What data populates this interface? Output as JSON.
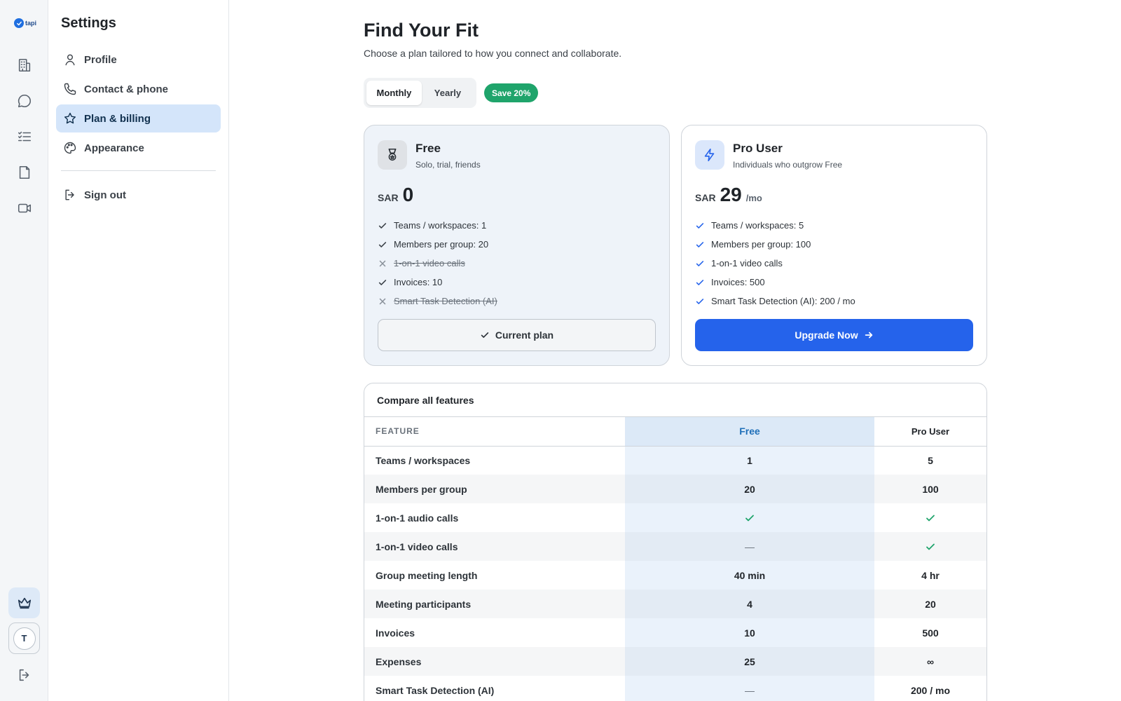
{
  "app": {
    "logo_text": "tapi"
  },
  "settings": {
    "title": "Settings",
    "items": [
      {
        "label": "Profile",
        "icon": "user-icon"
      },
      {
        "label": "Contact & phone",
        "icon": "phone-icon"
      },
      {
        "label": "Plan & billing",
        "icon": "star-icon",
        "active": true
      },
      {
        "label": "Appearance",
        "icon": "palette-icon"
      }
    ],
    "sign_out": "Sign out"
  },
  "rail": {
    "avatar_initial": "T"
  },
  "main": {
    "title": "Find Your Fit",
    "subtitle": "Choose a plan tailored to how you connect and collaborate.",
    "billing_toggle": {
      "monthly": "Monthly",
      "yearly": "Yearly",
      "selected": "Monthly"
    },
    "save_badge": "Save 20%"
  },
  "plans": {
    "free": {
      "name": "Free",
      "desc": "Solo, trial, friends",
      "currency": "SAR",
      "price": "0",
      "features": [
        {
          "text": "Teams / workspaces: 1",
          "included": true
        },
        {
          "text": "Members per group: 20",
          "included": true
        },
        {
          "text": "1-on-1 video calls",
          "included": false
        },
        {
          "text": "Invoices: 10",
          "included": true
        },
        {
          "text": "Smart Task Detection (AI)",
          "included": false
        }
      ],
      "cta": "Current plan"
    },
    "pro": {
      "name": "Pro User",
      "desc": "Individuals who outgrow Free",
      "currency": "SAR",
      "price": "29",
      "period": "/mo",
      "features": [
        {
          "text": "Teams / workspaces: 5",
          "included": true
        },
        {
          "text": "Members per group: 100",
          "included": true
        },
        {
          "text": "1-on-1 video calls",
          "included": true
        },
        {
          "text": "Invoices: 500",
          "included": true
        },
        {
          "text": "Smart Task Detection (AI): 200 / mo",
          "included": true
        }
      ],
      "cta": "Upgrade Now"
    }
  },
  "compare": {
    "title": "Compare all features",
    "headers": {
      "feature": "FEATURE",
      "free": "Free",
      "pro": "Pro User"
    },
    "rows": [
      {
        "feature": "Teams / workspaces",
        "free": "1",
        "pro": "5"
      },
      {
        "feature": "Members per group",
        "free": "20",
        "pro": "100"
      },
      {
        "feature": "1-on-1 audio calls",
        "free": "check",
        "pro": "check"
      },
      {
        "feature": "1-on-1 video calls",
        "free": "—",
        "pro": "check"
      },
      {
        "feature": "Group meeting length",
        "free": "40 min",
        "pro": "4 hr"
      },
      {
        "feature": "Meeting participants",
        "free": "4",
        "pro": "20"
      },
      {
        "feature": "Invoices",
        "free": "10",
        "pro": "500"
      },
      {
        "feature": "Expenses",
        "free": "25",
        "pro": "∞"
      },
      {
        "feature": "Smart Task Detection (AI)",
        "free": "—",
        "pro": "200 / mo"
      }
    ]
  },
  "colors": {
    "accent": "#2563eb",
    "success": "#1fa46b",
    "active_nav": "#d4e5fa"
  }
}
